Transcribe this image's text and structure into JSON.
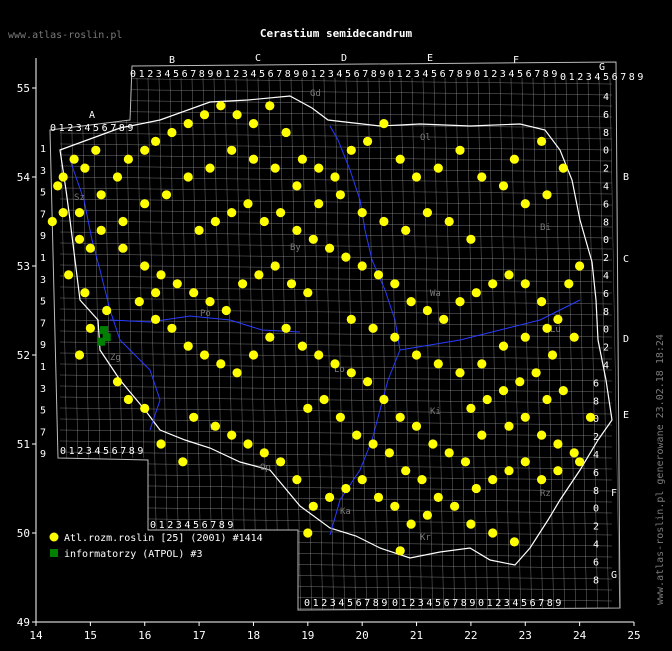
{
  "site_label": "www.atlas-roslin.pl",
  "title": "Cerastium semidecandrum",
  "side_note": "www.atlas-roslin.pl generowane 23.02.18 18:24",
  "colors": {
    "background": "#000000",
    "grid": "#9a9a9a",
    "labels": "#ffffff",
    "point_atlas": "#ffff00",
    "point_atpol": "#008000",
    "border": "#ffffff",
    "rivers": "#2a3cff"
  },
  "axes": {
    "x_ticks": [
      "14",
      "15",
      "16",
      "17",
      "18",
      "19",
      "20",
      "21",
      "22",
      "23",
      "24",
      "25"
    ],
    "y_ticks": [
      "55",
      "54",
      "53",
      "52",
      "51",
      "50",
      "49"
    ]
  },
  "atpol": {
    "column_letters": [
      "A",
      "B",
      "C",
      "D",
      "E",
      "F",
      "G"
    ],
    "row_letters": [
      "A",
      "B",
      "C",
      "D",
      "E",
      "F",
      "G"
    ],
    "column_digits": [
      "0",
      "1",
      "2",
      "3",
      "4",
      "5",
      "6",
      "7",
      "8",
      "9"
    ],
    "row_digits": [
      "1",
      "3",
      "5",
      "7",
      "9",
      "1",
      "3",
      "5",
      "7",
      "9",
      "1",
      "3",
      "5",
      "7",
      "9"
    ],
    "right_digits": [
      "4",
      "6",
      "8",
      "0",
      "2",
      "4",
      "6",
      "8",
      "0",
      "2",
      "4",
      "6",
      "8",
      "0",
      "2",
      "4",
      "6",
      "8",
      "0",
      "2",
      "4",
      "6",
      "8",
      "0",
      "2",
      "4",
      "6",
      "8"
    ]
  },
  "legend": [
    {
      "label": "Atl.rozm.roslin [25] (2001) #1414",
      "symbol": "circle",
      "color": "#ffff00"
    },
    {
      "label": "informatorzy (ATPOL) #3",
      "symbol": "square",
      "color": "#008000"
    }
  ],
  "place_codes": [
    "Sz",
    "Gd",
    "Ol",
    "By",
    "Bi",
    "Po",
    "Wa",
    "Lo",
    "Lu",
    "Wr",
    "Ki",
    "Op",
    "Ka",
    "Kr",
    "Rz",
    "Zg"
  ],
  "chart_data": {
    "type": "scatter",
    "xlabel": "",
    "ylabel": "",
    "xlim": [
      14,
      25
    ],
    "ylim": [
      49,
      55.3
    ],
    "series": [
      {
        "name": "Atl.rozm.roslin [25] (2001) #1414",
        "marker": "circle",
        "color": "#ffff00",
        "points": [
          [
            14.5,
            54.0
          ],
          [
            14.7,
            54.2
          ],
          [
            14.9,
            54.1
          ],
          [
            15.1,
            54.3
          ],
          [
            14.3,
            53.5
          ],
          [
            14.5,
            53.6
          ],
          [
            14.8,
            53.3
          ],
          [
            15.0,
            53.2
          ],
          [
            14.6,
            52.9
          ],
          [
            14.9,
            52.7
          ],
          [
            15.3,
            52.5
          ],
          [
            15.0,
            52.3
          ],
          [
            14.8,
            52.0
          ],
          [
            15.5,
            51.7
          ],
          [
            15.7,
            51.5
          ],
          [
            16.0,
            51.4
          ],
          [
            16.3,
            51.0
          ],
          [
            16.7,
            50.8
          ],
          [
            15.2,
            53.8
          ],
          [
            15.5,
            54.0
          ],
          [
            15.7,
            54.2
          ],
          [
            16.0,
            54.3
          ],
          [
            16.2,
            54.4
          ],
          [
            16.5,
            54.5
          ],
          [
            16.8,
            54.6
          ],
          [
            17.1,
            54.7
          ],
          [
            17.4,
            54.8
          ],
          [
            17.7,
            54.7
          ],
          [
            18.0,
            54.6
          ],
          [
            18.3,
            54.8
          ],
          [
            18.6,
            54.5
          ],
          [
            18.9,
            54.2
          ],
          [
            19.2,
            54.1
          ],
          [
            19.5,
            54.0
          ],
          [
            19.8,
            54.3
          ],
          [
            20.1,
            54.4
          ],
          [
            20.4,
            54.6
          ],
          [
            20.7,
            54.2
          ],
          [
            21.0,
            54.0
          ],
          [
            21.4,
            54.1
          ],
          [
            21.8,
            54.3
          ],
          [
            22.2,
            54.0
          ],
          [
            22.6,
            53.9
          ],
          [
            23.0,
            53.7
          ],
          [
            23.4,
            53.8
          ],
          [
            23.7,
            54.1
          ],
          [
            23.3,
            54.4
          ],
          [
            22.8,
            54.2
          ],
          [
            15.6,
            53.2
          ],
          [
            16.0,
            53.0
          ],
          [
            16.3,
            52.9
          ],
          [
            16.6,
            52.8
          ],
          [
            16.9,
            52.7
          ],
          [
            17.2,
            52.6
          ],
          [
            17.5,
            52.5
          ],
          [
            17.8,
            52.8
          ],
          [
            18.1,
            52.9
          ],
          [
            18.4,
            53.0
          ],
          [
            18.7,
            52.8
          ],
          [
            19.0,
            52.7
          ],
          [
            16.2,
            52.4
          ],
          [
            16.5,
            52.3
          ],
          [
            16.8,
            52.1
          ],
          [
            17.1,
            52.0
          ],
          [
            17.4,
            51.9
          ],
          [
            17.7,
            51.8
          ],
          [
            18.0,
            52.0
          ],
          [
            18.3,
            52.2
          ],
          [
            18.6,
            52.3
          ],
          [
            18.9,
            52.1
          ],
          [
            19.2,
            52.0
          ],
          [
            19.5,
            51.9
          ],
          [
            19.8,
            51.8
          ],
          [
            20.1,
            51.7
          ],
          [
            20.4,
            51.5
          ],
          [
            20.7,
            51.3
          ],
          [
            21.0,
            51.2
          ],
          [
            21.3,
            51.0
          ],
          [
            21.6,
            50.9
          ],
          [
            21.9,
            50.8
          ],
          [
            17.0,
            53.4
          ],
          [
            17.3,
            53.5
          ],
          [
            17.6,
            53.6
          ],
          [
            17.9,
            53.7
          ],
          [
            18.2,
            53.5
          ],
          [
            18.5,
            53.6
          ],
          [
            18.8,
            53.4
          ],
          [
            19.1,
            53.3
          ],
          [
            19.4,
            53.2
          ],
          [
            19.7,
            53.1
          ],
          [
            20.0,
            53.0
          ],
          [
            20.3,
            52.9
          ],
          [
            20.6,
            52.8
          ],
          [
            20.9,
            52.6
          ],
          [
            21.2,
            52.5
          ],
          [
            21.5,
            52.4
          ],
          [
            21.8,
            52.6
          ],
          [
            22.1,
            52.7
          ],
          [
            22.4,
            52.8
          ],
          [
            22.7,
            52.9
          ],
          [
            23.0,
            52.8
          ],
          [
            23.3,
            52.6
          ],
          [
            23.6,
            52.4
          ],
          [
            23.9,
            52.2
          ],
          [
            23.5,
            52.0
          ],
          [
            23.2,
            51.8
          ],
          [
            22.9,
            51.7
          ],
          [
            22.6,
            51.6
          ],
          [
            22.3,
            51.5
          ],
          [
            22.0,
            51.4
          ],
          [
            23.0,
            51.3
          ],
          [
            23.3,
            51.1
          ],
          [
            23.6,
            51.0
          ],
          [
            23.9,
            50.9
          ],
          [
            23.6,
            50.7
          ],
          [
            23.3,
            50.6
          ],
          [
            23.0,
            50.8
          ],
          [
            22.7,
            50.7
          ],
          [
            22.4,
            50.6
          ],
          [
            22.1,
            50.5
          ],
          [
            20.0,
            50.6
          ],
          [
            20.3,
            50.4
          ],
          [
            20.6,
            50.3
          ],
          [
            20.9,
            50.1
          ],
          [
            21.2,
            50.2
          ],
          [
            19.7,
            50.5
          ],
          [
            19.4,
            50.4
          ],
          [
            19.1,
            50.3
          ],
          [
            18.8,
            50.6
          ],
          [
            18.5,
            50.8
          ],
          [
            18.2,
            50.9
          ],
          [
            17.9,
            51.0
          ],
          [
            17.6,
            51.1
          ],
          [
            17.3,
            51.2
          ],
          [
            16.9,
            51.3
          ],
          [
            19.0,
            51.4
          ],
          [
            19.3,
            51.5
          ],
          [
            19.6,
            51.3
          ],
          [
            19.9,
            51.1
          ],
          [
            20.2,
            51.0
          ],
          [
            20.5,
            50.9
          ],
          [
            20.8,
            50.7
          ],
          [
            21.1,
            50.6
          ],
          [
            21.4,
            50.4
          ],
          [
            21.7,
            50.3
          ],
          [
            22.0,
            50.1
          ],
          [
            22.4,
            50.0
          ],
          [
            22.8,
            49.9
          ],
          [
            19.0,
            50.0
          ],
          [
            20.7,
            49.8
          ],
          [
            24.2,
            51.3
          ],
          [
            24.0,
            50.8
          ],
          [
            23.8,
            52.8
          ],
          [
            24.0,
            53.0
          ],
          [
            22.0,
            53.3
          ],
          [
            21.6,
            53.5
          ],
          [
            21.2,
            53.6
          ],
          [
            20.8,
            53.4
          ],
          [
            20.4,
            53.5
          ],
          [
            20.0,
            53.6
          ],
          [
            19.6,
            53.8
          ],
          [
            19.2,
            53.7
          ],
          [
            18.8,
            53.9
          ],
          [
            18.4,
            54.1
          ],
          [
            18.0,
            54.2
          ],
          [
            17.6,
            54.3
          ],
          [
            17.2,
            54.1
          ],
          [
            16.8,
            54.0
          ],
          [
            16.4,
            53.8
          ],
          [
            16.0,
            53.7
          ],
          [
            15.6,
            53.5
          ],
          [
            15.2,
            53.4
          ],
          [
            14.8,
            53.6
          ],
          [
            14.4,
            53.9
          ],
          [
            15.9,
            52.6
          ],
          [
            16.2,
            52.7
          ],
          [
            19.8,
            52.4
          ],
          [
            20.2,
            52.3
          ],
          [
            20.6,
            52.2
          ],
          [
            21.0,
            52.0
          ],
          [
            21.4,
            51.9
          ],
          [
            21.8,
            51.8
          ],
          [
            22.2,
            51.9
          ],
          [
            22.6,
            52.1
          ],
          [
            23.0,
            52.2
          ],
          [
            23.4,
            52.3
          ],
          [
            23.7,
            51.6
          ],
          [
            23.4,
            51.5
          ],
          [
            22.7,
            51.2
          ],
          [
            22.2,
            51.1
          ]
        ]
      },
      {
        "name": "informatorzy (ATPOL) #3",
        "marker": "square",
        "color": "#008000",
        "points": [
          [
            15.25,
            52.28
          ],
          [
            15.3,
            52.2
          ],
          [
            15.2,
            52.15
          ]
        ]
      }
    ]
  }
}
